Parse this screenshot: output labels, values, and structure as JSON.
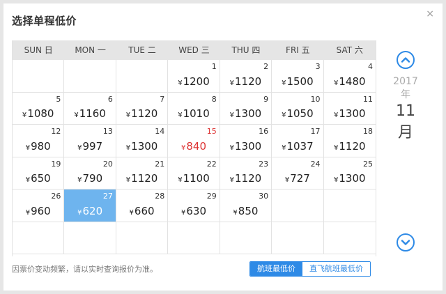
{
  "dialog": {
    "title": "选择单程低价",
    "close_label": "×"
  },
  "weekdays": [
    "SUN 日",
    "MON 一",
    "TUE 二",
    "WED 三",
    "THU 四",
    "FRI 五",
    "SAT 六"
  ],
  "calendar": {
    "cells": [
      {
        "day": "",
        "price": ""
      },
      {
        "day": "",
        "price": ""
      },
      {
        "day": "",
        "price": ""
      },
      {
        "day": "1",
        "price": "1200"
      },
      {
        "day": "2",
        "price": "1120"
      },
      {
        "day": "3",
        "price": "1500"
      },
      {
        "day": "4",
        "price": "1480"
      },
      {
        "day": "5",
        "price": "1080"
      },
      {
        "day": "6",
        "price": "1160"
      },
      {
        "day": "7",
        "price": "1120"
      },
      {
        "day": "8",
        "price": "1010"
      },
      {
        "day": "9",
        "price": "1300"
      },
      {
        "day": "10",
        "price": "1050"
      },
      {
        "day": "11",
        "price": "1300"
      },
      {
        "day": "12",
        "price": "980"
      },
      {
        "day": "13",
        "price": "997"
      },
      {
        "day": "14",
        "price": "1300"
      },
      {
        "day": "15",
        "price": "840",
        "lowest": true
      },
      {
        "day": "16",
        "price": "1300"
      },
      {
        "day": "17",
        "price": "1037"
      },
      {
        "day": "18",
        "price": "1120"
      },
      {
        "day": "19",
        "price": "650"
      },
      {
        "day": "20",
        "price": "790"
      },
      {
        "day": "21",
        "price": "1120"
      },
      {
        "day": "22",
        "price": "1100"
      },
      {
        "day": "23",
        "price": "1120"
      },
      {
        "day": "24",
        "price": "727"
      },
      {
        "day": "25",
        "price": "1300"
      },
      {
        "day": "26",
        "price": "960"
      },
      {
        "day": "27",
        "price": "620",
        "selected": true
      },
      {
        "day": "28",
        "price": "660"
      },
      {
        "day": "29",
        "price": "630"
      },
      {
        "day": "30",
        "price": "850"
      },
      {
        "day": "",
        "price": ""
      },
      {
        "day": "",
        "price": ""
      },
      {
        "day": "",
        "price": ""
      },
      {
        "day": "",
        "price": ""
      },
      {
        "day": "",
        "price": ""
      },
      {
        "day": "",
        "price": ""
      },
      {
        "day": "",
        "price": ""
      },
      {
        "day": "",
        "price": ""
      },
      {
        "day": "",
        "price": ""
      }
    ]
  },
  "nav": {
    "year": "2017年",
    "month": "11月",
    "prev_icon": "chevron-up-icon",
    "next_icon": "chevron-down-icon"
  },
  "footer": {
    "note": "因票价变动频繁，请以实时查询报价为准。",
    "btn_flight_lowest": "航班最低价",
    "btn_direct_lowest": "直飞航班最低价"
  },
  "colors": {
    "accent": "#2e8ae6",
    "selected_bg": "#6eb4ee",
    "lowest_price": "#d33333",
    "header_bg": "#e5e5e5"
  }
}
